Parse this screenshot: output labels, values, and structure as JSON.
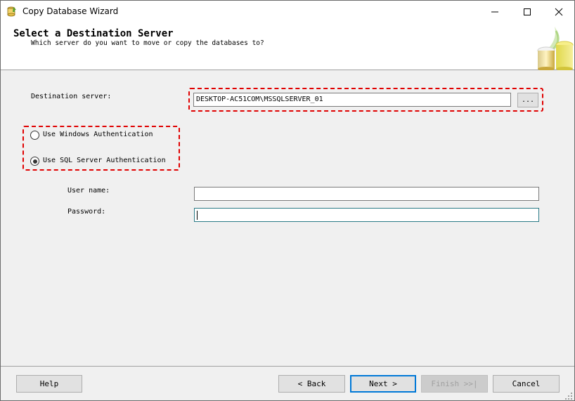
{
  "window": {
    "title": "Copy Database Wizard",
    "minimize_glyph": "—",
    "maximize_glyph": "☐",
    "close_glyph": "✕"
  },
  "header": {
    "title": "Select a Destination Server",
    "subtitle": "Which server do you want to move or copy the databases to?"
  },
  "form": {
    "destination_label": "Destination server:",
    "destination_value": "DESKTOP-AC51COM\\MSSQLSERVER_01",
    "browse_label": "...",
    "auth_windows_label": "Use Windows Authentication",
    "auth_sql_label": "Use SQL Server Authentication",
    "auth_selected": "sql",
    "username_label": "User name:",
    "username_value": "",
    "password_label": "Password:",
    "password_value": ""
  },
  "buttons": {
    "help": "Help",
    "back": "< Back",
    "next": "Next >",
    "finish": "Finish >>|",
    "cancel": "Cancel"
  },
  "colors": {
    "highlight": "#e00000",
    "focus_border": "#2b7a86",
    "default_button_border": "#0078d7"
  }
}
